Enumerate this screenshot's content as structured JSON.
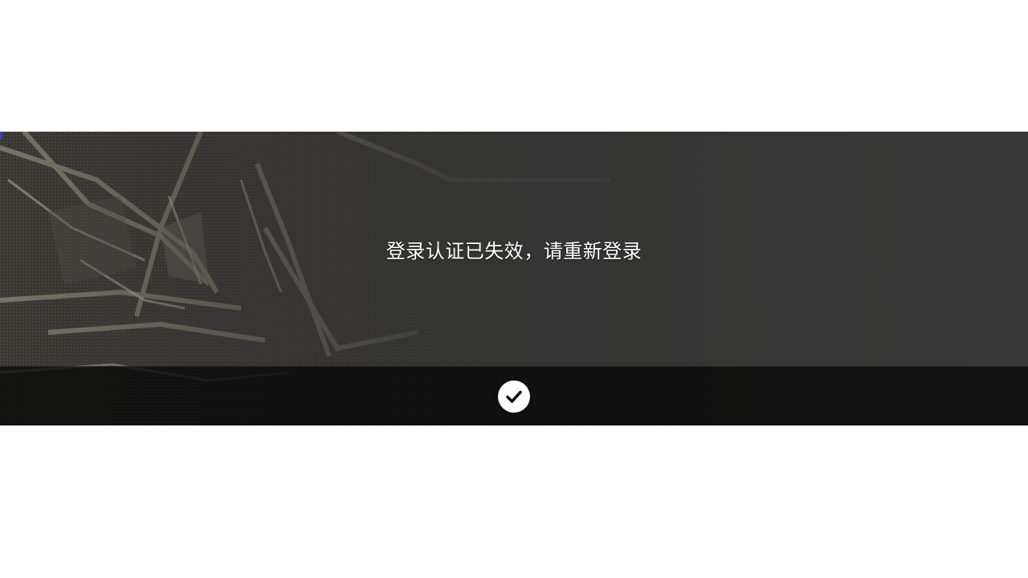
{
  "dialog": {
    "message": "登录认证已失效，请重新登录",
    "confirm_icon": "check-icon"
  },
  "colors": {
    "page_background": "#ffffff",
    "dialog_background": "#2e2e2e",
    "footer_background": "#0a0a0a",
    "message_text": "#ffffff",
    "button_background": "#ffffff",
    "button_icon": "#111111"
  }
}
